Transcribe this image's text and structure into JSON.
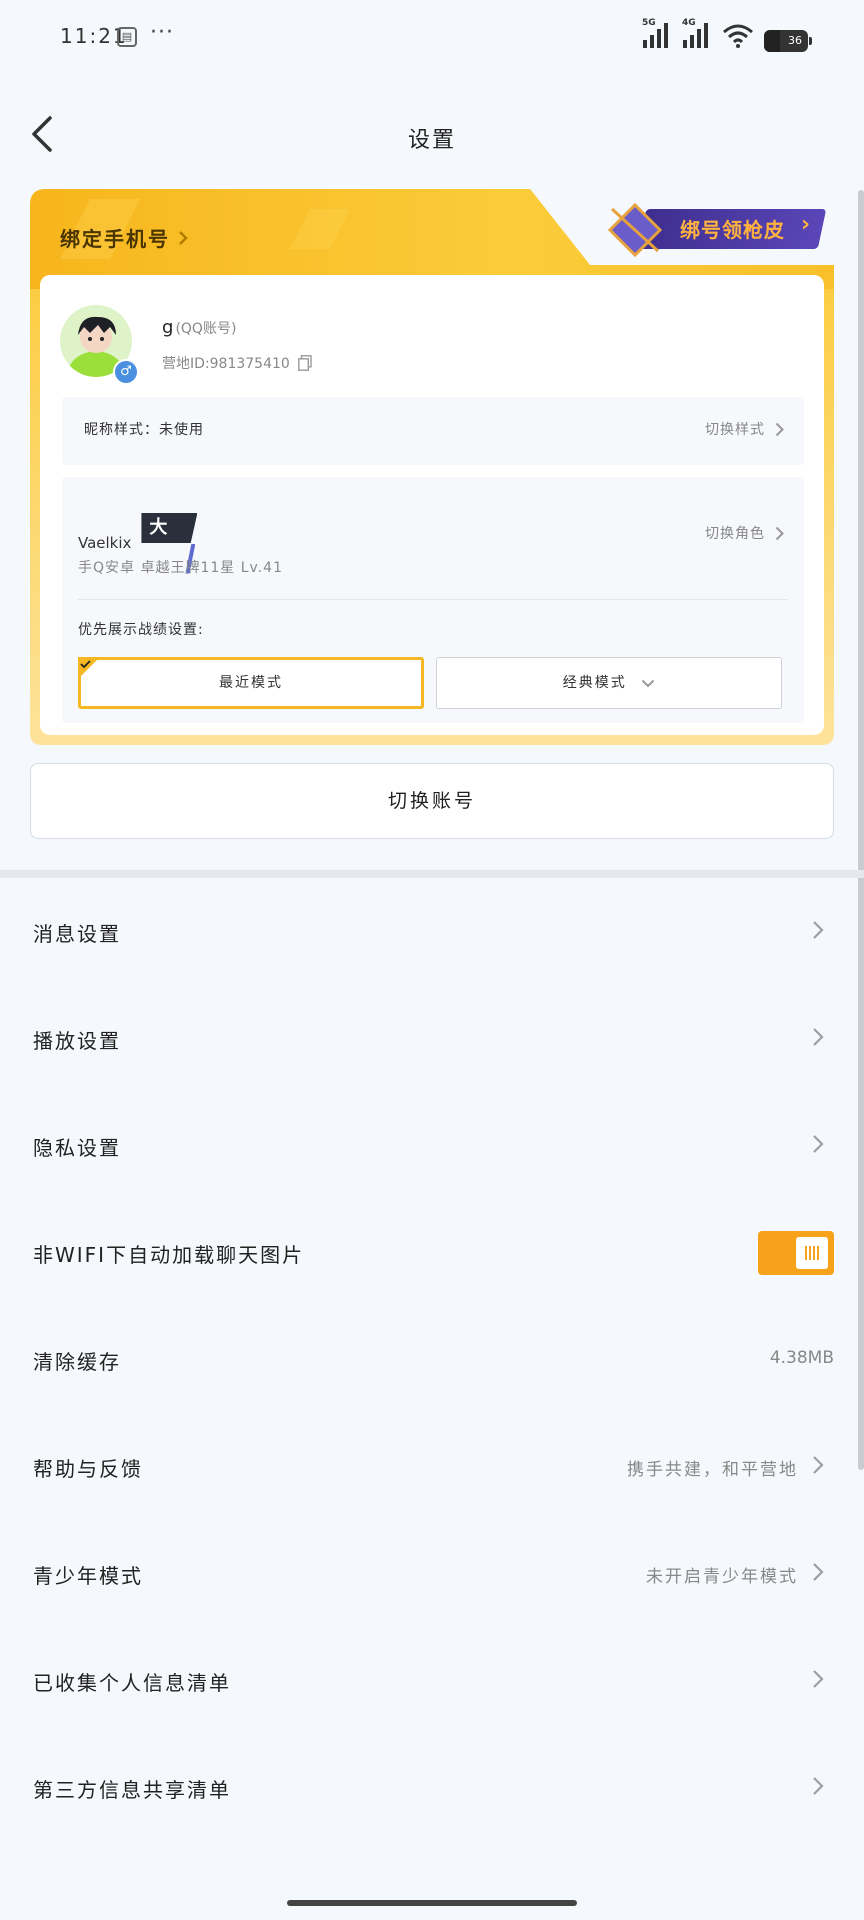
{
  "status_bar": {
    "time": "11:21",
    "notification_icon": "calendar-icon",
    "more": "···",
    "signal_5g": "5G",
    "signal_4g": "4G",
    "battery": "36"
  },
  "nav": {
    "title": "设置",
    "back_icon": "chevron-left-icon"
  },
  "account_card": {
    "bind_phone": "绑定手机号",
    "promo": "绑号领枪皮",
    "user": {
      "name": "g",
      "account_type": "(QQ账号)",
      "camp_id_label": "营地ID:981375410",
      "gender": "♂"
    },
    "nickname_style": {
      "label": "昵称样式：未使用",
      "action": "切换样式"
    },
    "role": {
      "name": "Vaelkix",
      "badge": "大号",
      "detail": "手Q安卓   卓越王牌11星   Lv.41",
      "action": "切换角色"
    },
    "preferred_display": {
      "label": "优先展示战绩设置:",
      "modes": [
        "最近模式",
        "经典模式"
      ],
      "selected": "最近模式"
    }
  },
  "switch_account": "切换账号",
  "settings": [
    {
      "label": "消息设置",
      "type": "chevron"
    },
    {
      "label": "播放设置",
      "type": "chevron"
    },
    {
      "label": "隐私设置",
      "type": "chevron"
    },
    {
      "label": "非WIFI下自动加载聊天图片",
      "type": "toggle",
      "on": true
    },
    {
      "label": "清除缓存",
      "type": "value",
      "value": "4.38MB"
    },
    {
      "label": "帮助与反馈",
      "type": "value-chevron",
      "value": "携手共建，和平营地"
    },
    {
      "label": "青少年模式",
      "type": "value-chevron",
      "value": "未开启青少年模式"
    },
    {
      "label": "已收集个人信息清单",
      "type": "chevron"
    },
    {
      "label": "第三方信息共享清单",
      "type": "chevron"
    }
  ],
  "colors": {
    "accent": "#f6b822",
    "toggle_on": "#f6a21a",
    "promo_band": "#4a38a6",
    "promo_text": "#ffb23e",
    "background": "#f5f8fc"
  }
}
